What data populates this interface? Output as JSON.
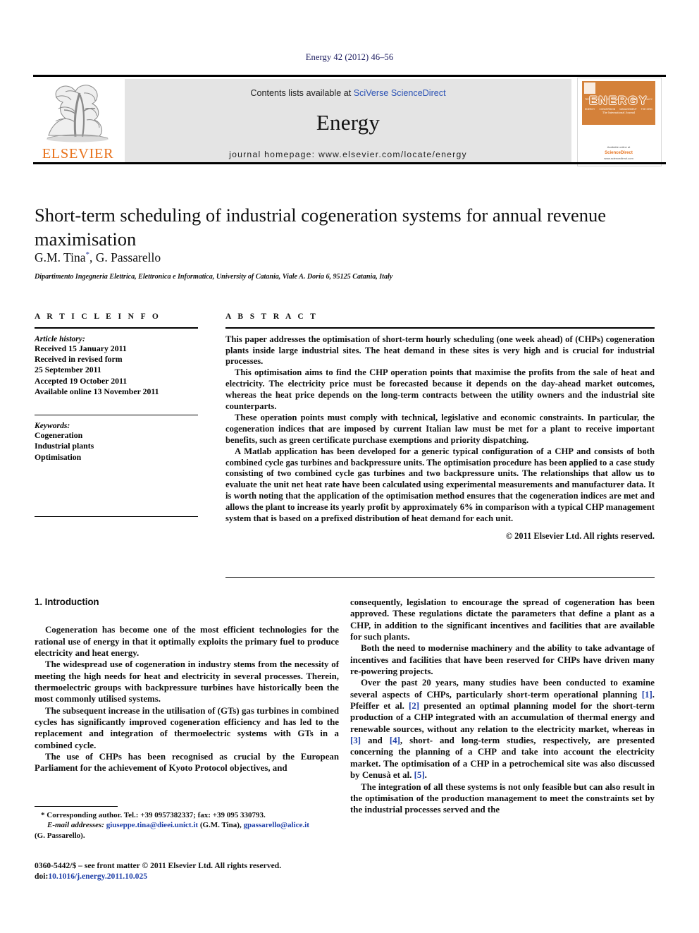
{
  "running_head": "Energy 42 (2012) 46–56",
  "masthead": {
    "publisher_logo_label": "ELSEVIER",
    "contents_prefix": "Contents lists available at ",
    "contents_link": "SciVerse ScienceDirect",
    "journal_title": "Energy",
    "homepage": "journal homepage: www.elsevier.com/locate/energy",
    "cover": {
      "title": "ENERGY",
      "subtitle": "The International Journal",
      "top_labels": [
        "TECHNOLOGY",
        "ECONOMY",
        "PLANNING",
        "POLICY"
      ],
      "bottom_labels": [
        "ENERGY",
        "CONVERSION",
        "MANAGEMENT",
        "THE GRID"
      ],
      "footer_line1": "Available online at",
      "footer_line2": "ScienceDirect",
      "footer_line3": "www.sciencedirect.com"
    }
  },
  "article": {
    "title": "Short-term scheduling of industrial cogeneration systems for annual revenue maximisation",
    "authors": "G.M. Tina",
    "authors_marker": "*",
    "authors_rest": ", G. Passarello",
    "affiliation": "Dipartimento Ingegneria Elettrica, Elettronica e Informatica, University of Catania, Viale A. Doria 6, 95125 Catania, Italy"
  },
  "article_info": {
    "heading": "A R T I C L E  I N F O",
    "history_label": "Article history:",
    "history": [
      "Received 15 January 2011",
      "Received in revised form",
      "25 September 2011",
      "Accepted 19 October 2011",
      "Available online 13 November 2011"
    ],
    "keywords_label": "Keywords:",
    "keywords": [
      "Cogeneration",
      "Industrial plants",
      "Optimisation"
    ]
  },
  "abstract": {
    "heading": "A B S T R A C T",
    "paragraphs": [
      "This paper addresses the optimisation of short-term hourly scheduling (one week ahead) of (CHPs) cogeneration plants inside large industrial sites. The heat demand in these sites is very high and is crucial for industrial processes.",
      "This optimisation aims to find the CHP operation points that maximise the profits from the sale of heat and electricity. The electricity price must be forecasted because it depends on the day-ahead market outcomes, whereas the heat price depends on the long-term contracts between the utility owners and the industrial site counterparts.",
      "These operation points must comply with technical, legislative and economic constraints. In particular, the cogeneration indices that are imposed by current Italian law must be met for a plant to receive important benefits, such as green certificate purchase exemptions and priority dispatching.",
      "A Matlab application has been developed for a generic typical configuration of a CHP and consists of both combined cycle gas turbines and backpressure units. The optimisation procedure has been applied to a case study consisting of two combined cycle gas turbines and two backpressure units. The relationships that allow us to evaluate the unit net heat rate have been calculated using experimental measurements and manufacturer data. It is worth noting that the application of the optimisation method ensures that the cogeneration indices are met and allows the plant to increase its yearly profit by approximately 6% in comparison with a typical CHP management system that is based on a prefixed distribution of heat demand for each unit."
    ],
    "copyright": "© 2011 Elsevier Ltd. All rights reserved."
  },
  "introduction": {
    "heading": "1. Introduction",
    "left_paragraphs": [
      "Cogeneration has become one of the most efficient technologies for the rational use of energy in that it optimally exploits the primary fuel to produce electricity and heat energy.",
      "The widespread use of cogeneration in industry stems from the necessity of meeting the high needs for heat and electricity in several processes. Therein, thermoelectric groups with backpressure turbines have historically been the most commonly utilised systems.",
      "The subsequent increase in the utilisation of (GTs) gas turbines in combined cycles has significantly improved cogeneration efficiency and has led to the replacement and integration of thermoelectric systems with GTs in a combined cycle.",
      "The use of CHPs has been recognised as crucial by the European Parliament for the achievement of Kyoto Protocol objectives, and"
    ],
    "right_paragraphs": [
      "consequently, legislation to encourage the spread of cogeneration has been approved. These regulations dictate the parameters that define a plant as a CHP, in addition to the significant incentives and facilities that are available for such plants.",
      "Both the need to modernise machinery and the ability to take advantage of incentives and facilities that have been reserved for CHPs have driven many re-powering projects.",
      "The integration of all these systems is not only feasible but can also result in the optimisation of the production management to meet the constraints set by the industrial processes served and the"
    ],
    "right_ref_paragraph": {
      "part1": "Over the past 20 years, many studies have been conducted to examine several aspects of CHPs, particularly short-term operational planning ",
      "ref1": "[1]",
      "part2": ". Pfeiffer et al. ",
      "ref2": "[2]",
      "part3": " presented an optimal planning model for the short-term production of a CHP integrated with an accumulation of thermal energy and renewable sources, without any relation to the electricity market, whereas in ",
      "ref3": "[3]",
      "part4": " and ",
      "ref4": "[4]",
      "part5": ", short- and long-term studies, respectively, are presented concerning the planning of a CHP and take into account the electricity market. The optimisation of a CHP in a petrochemical site was also discussed by Cenusà et al. ",
      "ref5": "[5]",
      "part6": "."
    }
  },
  "footnotes": {
    "corresponding": "* Corresponding author. Tel.: +39 0957382337; fax: +39 095 330793.",
    "email_label": "E-mail addresses:",
    "email1": "giuseppe.tina@dieei.unict.it",
    "email1_owner": " (G.M. Tina), ",
    "email2": "gpassarello@alice.it",
    "email2_owner": "(G. Passarello).",
    "imprint": "0360-5442/$ – see front matter © 2011 Elsevier Ltd. All rights reserved.",
    "doi_label": "doi:",
    "doi_value": "10.1016/j.energy.2011.10.025"
  },
  "colors": {
    "elsevier_orange": "#E8721C",
    "link_blue": "#1f3fa8",
    "runhead_navy": "#1a1a5e",
    "banner_grey": "#e4e4e4"
  }
}
